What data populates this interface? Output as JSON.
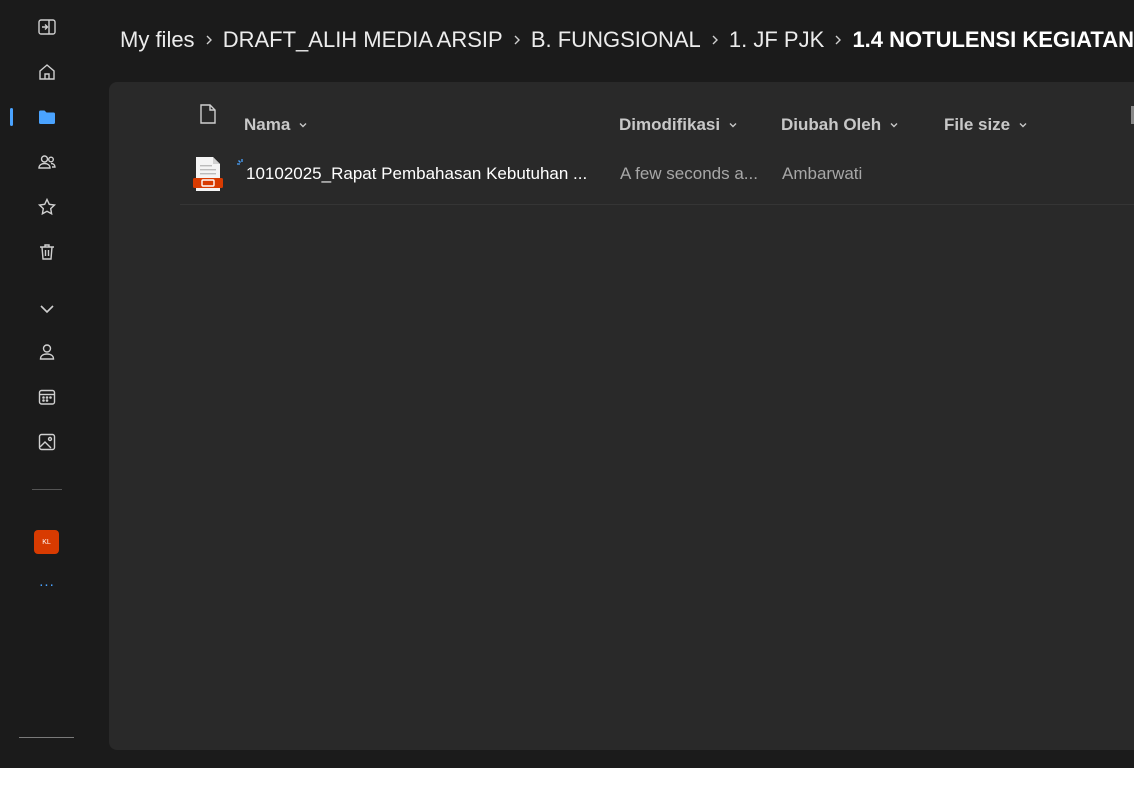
{
  "breadcrumb": {
    "items": [
      "My files",
      "DRAFT_ALIH MEDIA ARSIP",
      "B. FUNGSIONAL",
      "1. JF PJK"
    ],
    "current": "1.4 NOTULENSI KEGIATAN"
  },
  "columns": {
    "name": "Nama",
    "modified": "Dimodifikasi",
    "modified_by": "Diubah Oleh",
    "file_size": "File size"
  },
  "files": [
    {
      "name": "10102025_Rapat Pembahasan Kebutuhan ...",
      "modified": "A few seconds a...",
      "modified_by": "Ambarwati",
      "icon": "pdf-file-icon",
      "status_icon": "syncing-icon"
    }
  ],
  "rail": {
    "items": [
      "collapse-pane-icon",
      "home-icon",
      "my-files-folder-icon",
      "shared-people-icon",
      "favorites-star-icon",
      "recycle-bin-icon",
      "expand-chevron-icon",
      "person-icon",
      "calendar-icon",
      "photos-icon"
    ],
    "app_tile_label": "KL",
    "more_label": "..."
  },
  "colors": {
    "accent": "#4aa3ff",
    "background": "#1b1b1b",
    "content": "#292929",
    "pdf": "#d83b01"
  }
}
